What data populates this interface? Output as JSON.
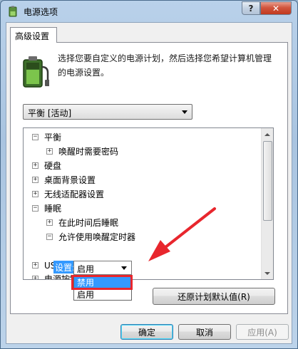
{
  "window": {
    "title": "电源选项",
    "help_label": "?",
    "close_label": "✕"
  },
  "tab": {
    "label": "高级设置"
  },
  "description": "选择您要自定义的电源计划，然后选择您希望计算机管理的电源设置。",
  "plan_select": {
    "value": "平衡 [活动]"
  },
  "tree": {
    "rows": [
      {
        "exp": "−",
        "label": "平衡"
      },
      {
        "exp": "+",
        "label": "唤醒时需要密码"
      },
      {
        "exp": "+",
        "label": "硬盘"
      },
      {
        "exp": "+",
        "label": "桌面背景设置"
      },
      {
        "exp": "+",
        "label": "无线适配器设置"
      },
      {
        "exp": "−",
        "label": "睡眠"
      },
      {
        "exp": "+",
        "label": "在此时间后睡眠"
      },
      {
        "exp": "−",
        "label": "允许使用唤醒定时器"
      },
      {
        "exp": "+",
        "label": "USB 设置"
      },
      {
        "exp": "+",
        "label": "电源按钮和盖"
      }
    ],
    "setting_label": "设置:",
    "setting_value": "启用",
    "dropdown_options": [
      "禁用",
      "启用"
    ]
  },
  "buttons": {
    "restore": "还原计划默认值(R)",
    "ok": "确定",
    "cancel": "取消",
    "apply": "应用(A)"
  },
  "colors": {
    "highlight": "#e8262d",
    "selection": "#3399ff"
  }
}
